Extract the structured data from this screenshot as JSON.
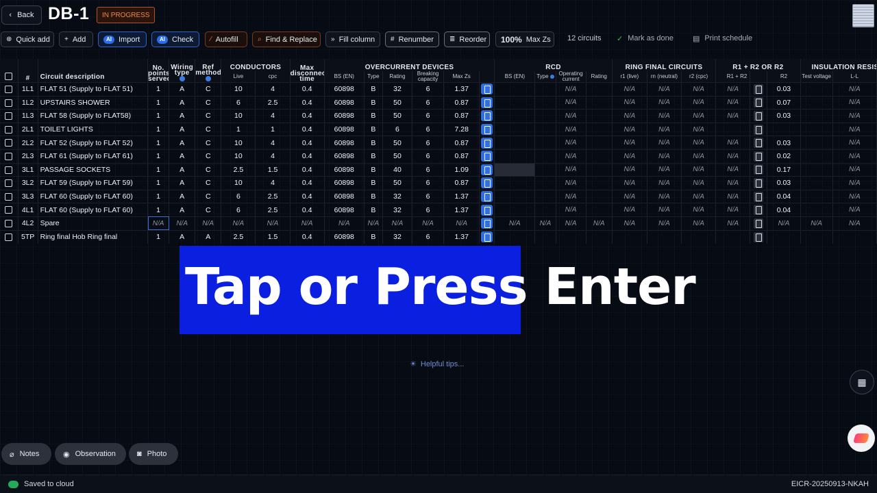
{
  "header": {
    "back_label": "Back",
    "title": "DB-1",
    "status": "IN PROGRESS"
  },
  "toolbar": {
    "quick_add": "Quick add",
    "add": "Add",
    "ai_badge": "AI",
    "import": "Import",
    "check": "Check",
    "autofill": "Autofill",
    "find_replace": "Find & Replace",
    "fill_column": "Fill column",
    "renumber": "Renumber",
    "reorder": "Reorder",
    "zoom_value": "100%",
    "max_zs": "Max Zs",
    "circuit_count": "12 circuits",
    "mark_done": "Mark as done",
    "print": "Print schedule"
  },
  "table": {
    "headers": {
      "num": "#",
      "description": "Circuit description",
      "points_served": "No. points served",
      "wiring_type": "Wiring type",
      "ref_method": "Ref method",
      "conductors": "CONDUCTORS",
      "live": "Live",
      "cpc": "cpc",
      "max_disconnect": "Max disconnect time",
      "overcurrent": "OVERCURRENT DEVICES",
      "bs_en": "BS (EN)",
      "type": "Type",
      "rating": "Rating",
      "breaking_capacity": "Breaking capacity",
      "max_zs": "Max Zs",
      "rcd": "RCD",
      "rcd_bs_en": "BS (EN)",
      "rcd_type": "Type",
      "operating_current": "Operating current",
      "rcd_rating": "Rating",
      "ring_final": "RING FINAL CIRCUITS",
      "r1_live": "r1 (live)",
      "rn_neutral": "rn (neutral)",
      "r2_cpc": "r2 (cpc)",
      "r1r2_group": "R1 + R2 OR R2",
      "r1r2": "R1 + R2",
      "r2": "R2",
      "insulation": "INSULATION RESIS",
      "test_voltage": "Test voltage",
      "ll": "L-L"
    },
    "na": "N/A",
    "rows": [
      {
        "num": "1L1",
        "desc": "FLAT 51 (Supply to FLAT 51)",
        "points": "1",
        "wiring": "A",
        "ref": "C",
        "live": "10",
        "cpc": "4",
        "disc": "0.4",
        "bs": "60898",
        "type": "B",
        "rating": "32",
        "breaking": "6",
        "max_zs": "1.37",
        "r2": "0.03"
      },
      {
        "num": "1L2",
        "desc": "UPSTAIRS SHOWER",
        "points": "1",
        "wiring": "A",
        "ref": "C",
        "live": "6",
        "cpc": "2.5",
        "disc": "0.4",
        "bs": "60898",
        "type": "B",
        "rating": "50",
        "breaking": "6",
        "max_zs": "0.87",
        "r2": "0.07"
      },
      {
        "num": "1L3",
        "desc": "FLAT 58 (Supply to FLAT58)",
        "points": "1",
        "wiring": "A",
        "ref": "C",
        "live": "10",
        "cpc": "4",
        "disc": "0.4",
        "bs": "60898",
        "type": "B",
        "rating": "50",
        "breaking": "6",
        "max_zs": "0.87",
        "r2": "0.03"
      },
      {
        "num": "2L1",
        "desc": "TOILET LIGHTS",
        "points": "1",
        "wiring": "A",
        "ref": "C",
        "live": "1",
        "cpc": "1",
        "disc": "0.4",
        "bs": "60898",
        "type": "B",
        "rating": "6",
        "breaking": "6",
        "max_zs": "7.28",
        "r2": ""
      },
      {
        "num": "2L2",
        "desc": "FLAT 52 (Supply to FLAT 52)",
        "points": "1",
        "wiring": "A",
        "ref": "C",
        "live": "10",
        "cpc": "4",
        "disc": "0.4",
        "bs": "60898",
        "type": "B",
        "rating": "50",
        "breaking": "6",
        "max_zs": "0.87",
        "r2": "0.03"
      },
      {
        "num": "2L3",
        "desc": "FLAT 61 (Supply to FLAT 61)",
        "points": "1",
        "wiring": "A",
        "ref": "C",
        "live": "10",
        "cpc": "4",
        "disc": "0.4",
        "bs": "60898",
        "type": "B",
        "rating": "50",
        "breaking": "6",
        "max_zs": "0.87",
        "r2": "0.02"
      },
      {
        "num": "3L1",
        "desc": "PASSAGE SOCKETS",
        "points": "1",
        "wiring": "A",
        "ref": "C",
        "live": "2.5",
        "cpc": "1.5",
        "disc": "0.4",
        "bs": "60898",
        "type": "B",
        "rating": "40",
        "breaking": "6",
        "max_zs": "1.09",
        "r2": "0.17"
      },
      {
        "num": "3L2",
        "desc": "FLAT 59 (Supply to FLAT 59)",
        "points": "1",
        "wiring": "A",
        "ref": "C",
        "live": "10",
        "cpc": "4",
        "disc": "0.4",
        "bs": "60898",
        "type": "B",
        "rating": "50",
        "breaking": "6",
        "max_zs": "0.87",
        "r2": "0.03"
      },
      {
        "num": "3L3",
        "desc": "FLAT 60 (Supply to FLAT 60)",
        "points": "1",
        "wiring": "A",
        "ref": "C",
        "live": "6",
        "cpc": "2.5",
        "disc": "0.4",
        "bs": "60898",
        "type": "B",
        "rating": "32",
        "breaking": "6",
        "max_zs": "1.37",
        "r2": "0.04"
      },
      {
        "num": "4L1",
        "desc": "FLAT 60 (Supply to FLAT 60)",
        "points": "1",
        "wiring": "A",
        "ref": "C",
        "live": "6",
        "cpc": "2.5",
        "disc": "0.4",
        "bs": "60898",
        "type": "B",
        "rating": "32",
        "breaking": "6",
        "max_zs": "1.37",
        "r2": "0.04"
      },
      {
        "num": "4L2",
        "desc": "Spare",
        "points": "N/A",
        "wiring": "N/A",
        "ref": "N/A",
        "live": "N/A",
        "cpc": "N/A",
        "disc": "N/A",
        "bs": "N/A",
        "type": "N/A",
        "rating": "N/A",
        "breaking": "N/A",
        "max_zs": "N/A",
        "r2": "N/A"
      },
      {
        "num": "5TP",
        "desc": "Ring final Hob Ring final",
        "points": "1",
        "wiring": "A",
        "ref": "A",
        "live": "2.5",
        "cpc": "1.5",
        "disc": "0.4",
        "bs": "60898",
        "type": "B",
        "rating": "32",
        "breaking": "6",
        "max_zs": "1.37",
        "r2": ""
      }
    ]
  },
  "caption": {
    "text": "Tap or Press Enter"
  },
  "tips": "Helpful tips...",
  "bottom": {
    "notes": "Notes",
    "observation": "Observation",
    "photo": "Photo"
  },
  "status": {
    "saved": "Saved to cloud",
    "reference": "EICR-20250913-NKAH"
  },
  "colors": {
    "accent_blue": "#2f6fe0",
    "status_orange": "#f0884c",
    "caption_blue": "#0a1fe0",
    "saved_green": "#27a95a"
  }
}
